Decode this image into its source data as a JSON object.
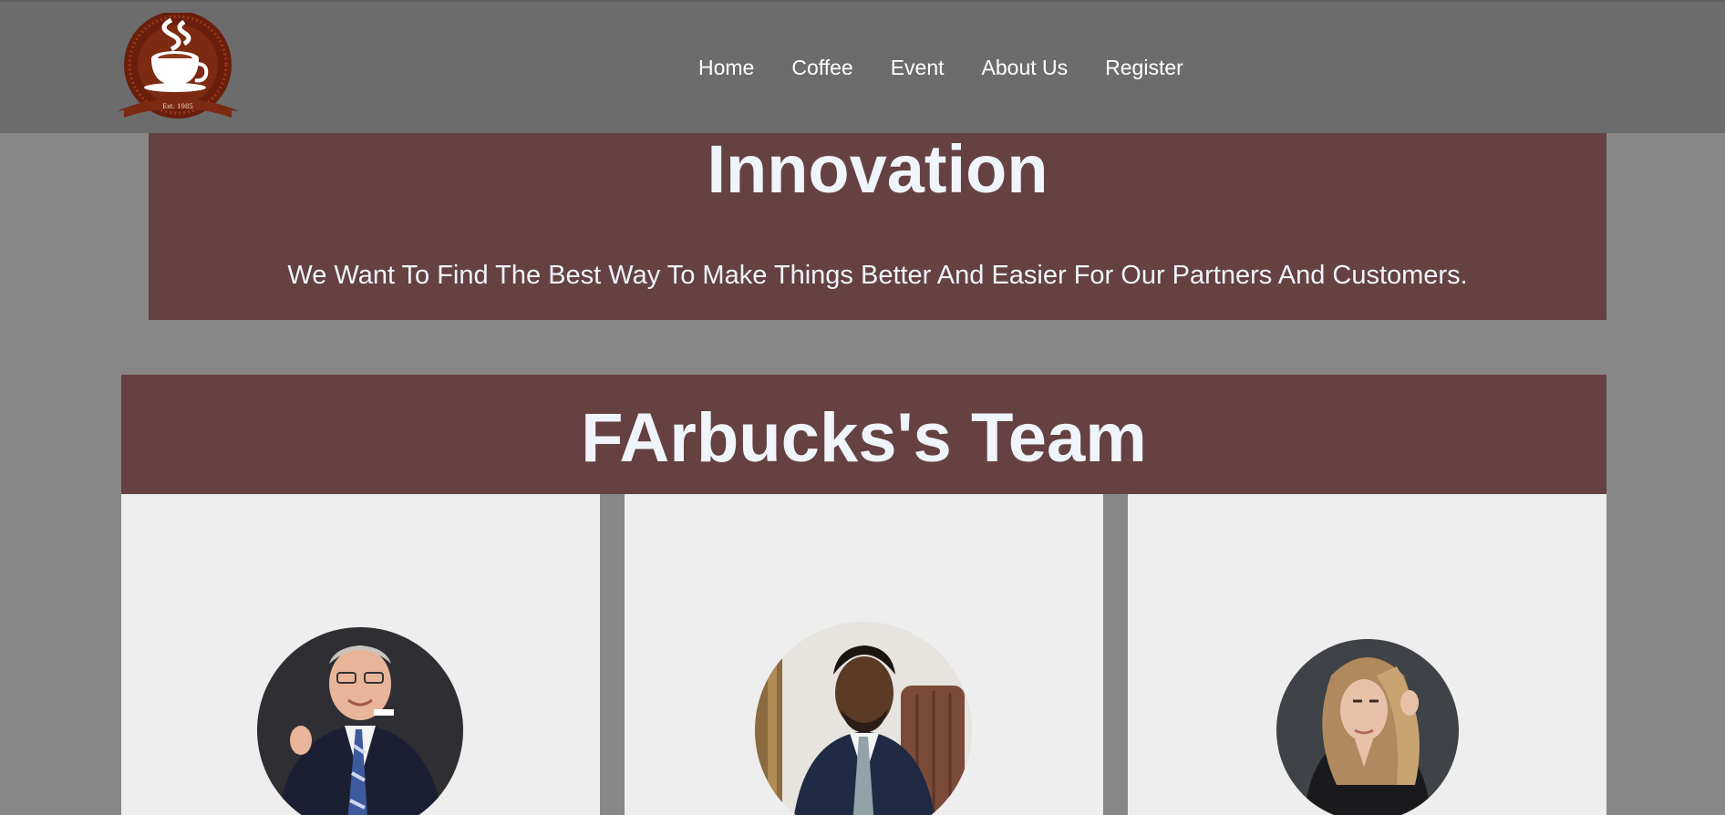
{
  "nav": {
    "logo_name": "coffee-cup-logo",
    "logo_text": "Est. 1985",
    "links": [
      "Home",
      "Coffee",
      "Event",
      "About Us",
      "Register"
    ]
  },
  "innovation": {
    "title": "Innovation",
    "text": "We Want To Find The Best Way To Make Things Better And Easier For Our Partners And Customers."
  },
  "team": {
    "title": "FArbucks's Team",
    "members": [
      {
        "photo": "team-member-1-photo"
      },
      {
        "photo": "team-member-2-photo"
      },
      {
        "photo": "team-member-3-photo"
      }
    ]
  },
  "colors": {
    "page_bg": "#878787",
    "navbar_bg": "#6c6c6c",
    "section_bg": "#654142",
    "card_bg": "#eeeeee",
    "heading_text": "#f0f4fb"
  }
}
